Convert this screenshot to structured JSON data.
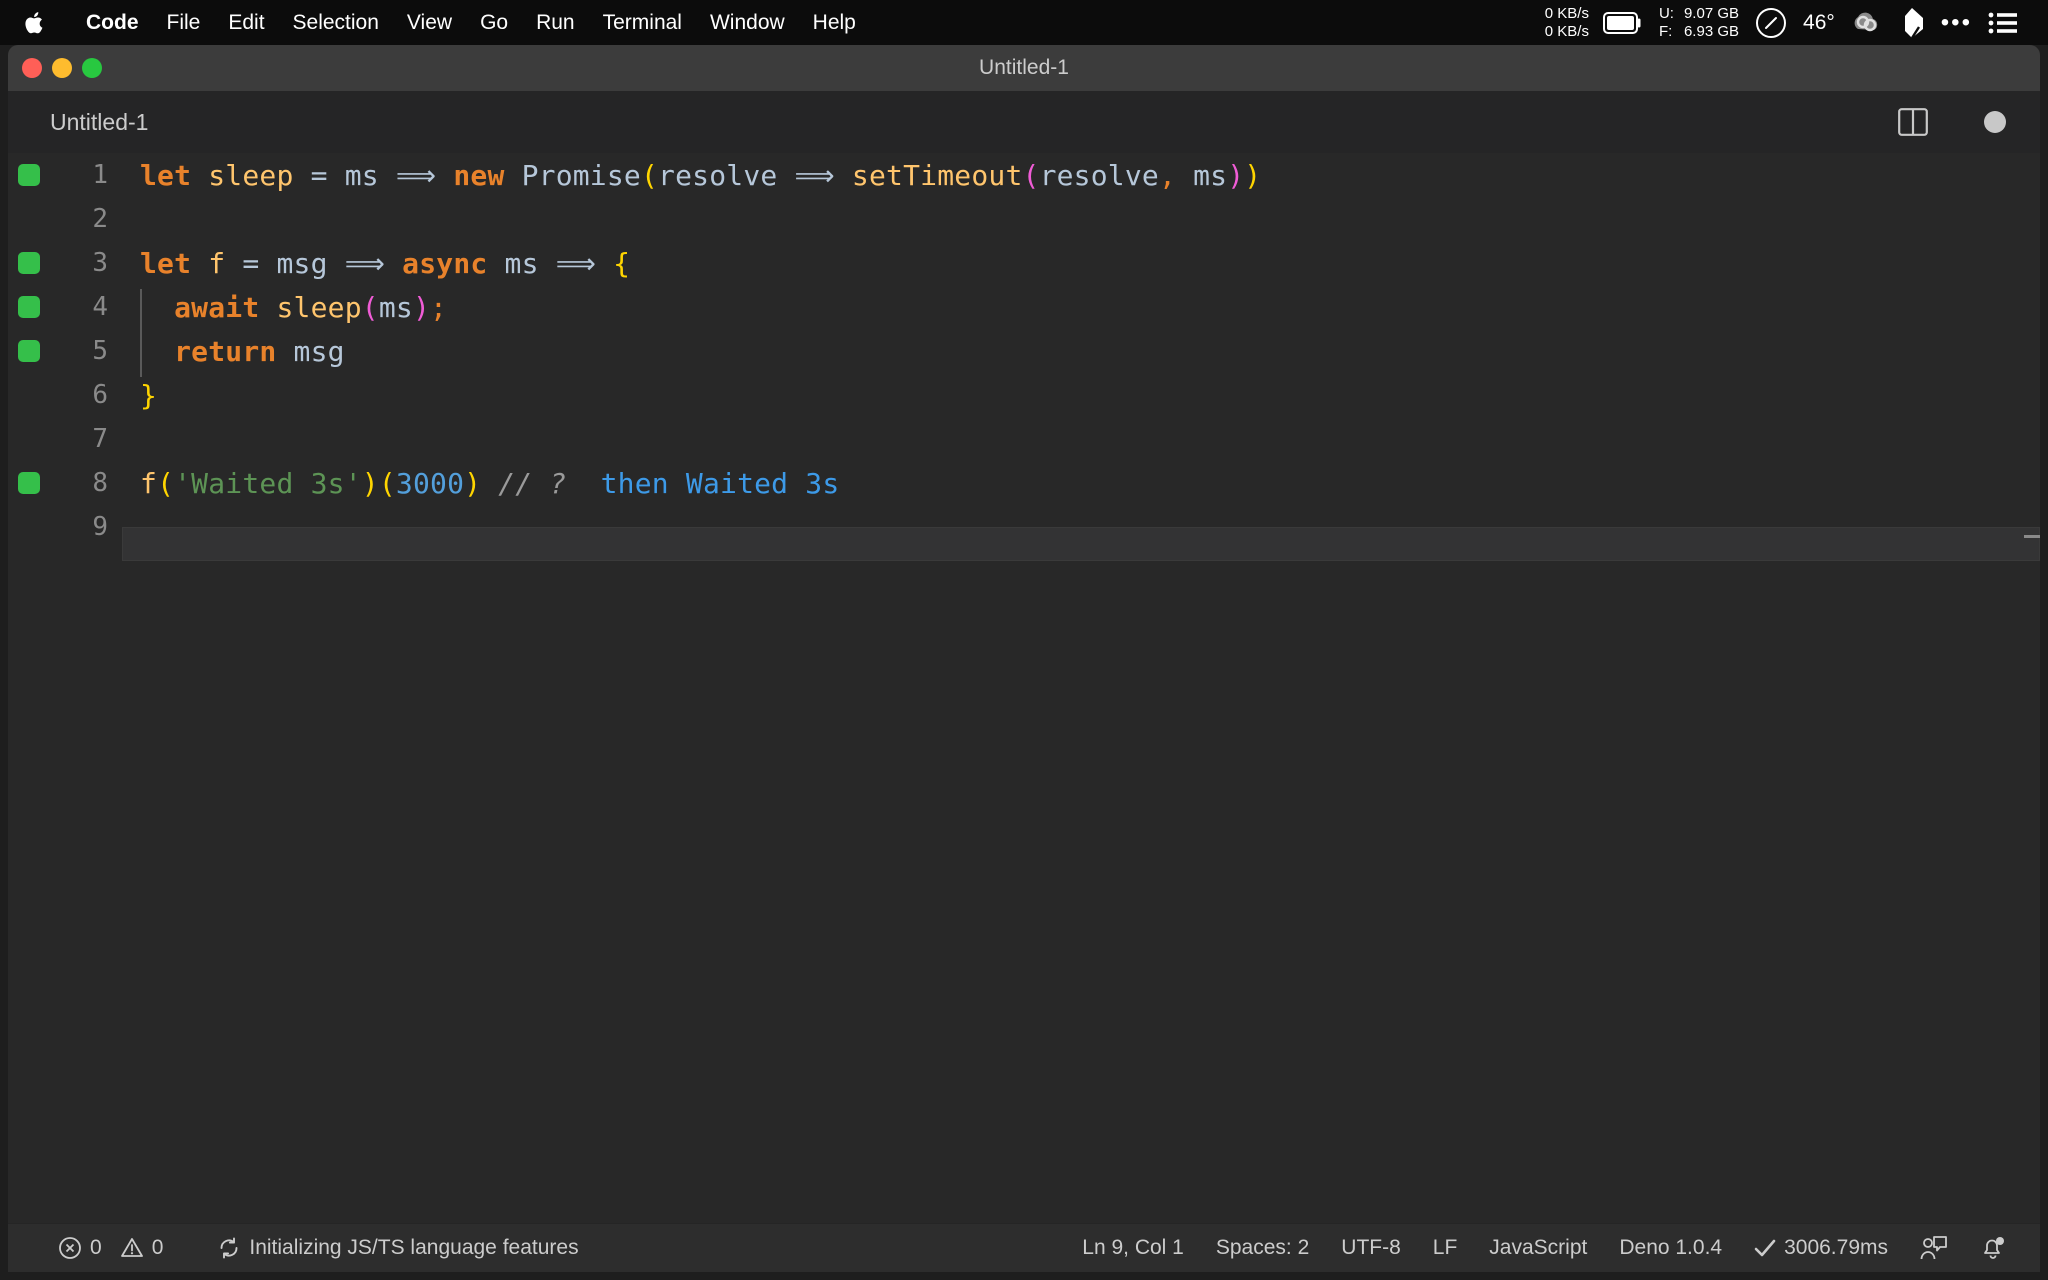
{
  "menubar": {
    "apple_icon": "apple-logo-icon",
    "items": [
      {
        "label": "Code",
        "bold": true
      },
      {
        "label": "File",
        "bold": false
      },
      {
        "label": "Edit",
        "bold": false
      },
      {
        "label": "Selection",
        "bold": false
      },
      {
        "label": "View",
        "bold": false
      },
      {
        "label": "Go",
        "bold": false
      },
      {
        "label": "Run",
        "bold": false
      },
      {
        "label": "Terminal",
        "bold": false
      },
      {
        "label": "Window",
        "bold": false
      },
      {
        "label": "Help",
        "bold": false
      }
    ],
    "network_up": "0 KB/s",
    "network_down": "0 KB/s",
    "battery_icon": "battery-icon",
    "memory_used_label": "U:",
    "memory_free_label": "F:",
    "memory_used_value": "9.07 GB",
    "memory_free_value": "6.93 GB",
    "gauge_icon": "speedometer-icon",
    "temperature": "46°",
    "cloud_icon": "cloud-sync-icon",
    "leaf_icon": "leaf-icon",
    "dots_icon": "ellipsis-icon",
    "list_icon": "control-center-list-icon"
  },
  "window": {
    "title": "Untitled-1",
    "traffic_lights": [
      "close",
      "minimize",
      "maximize"
    ],
    "colors": {
      "close": "#ff5f57",
      "minimize": "#febc2e",
      "maximize": "#28c840"
    }
  },
  "tabrow": {
    "tab_label": "Untitled-1",
    "split_editor_icon": "split-editor-icon",
    "unsaved_dot": "unsaved-changes-dot"
  },
  "editor": {
    "language": "javascript",
    "cursor_line": 9,
    "lines": [
      {
        "number": "1",
        "marked": true,
        "indent_guide": false,
        "current": false,
        "tokens": [
          {
            "t": "let",
            "c": "t-kw"
          },
          {
            "t": " ",
            "c": "t-op"
          },
          {
            "t": "sleep",
            "c": "t-var"
          },
          {
            "t": " = ",
            "c": "t-op"
          },
          {
            "t": "ms",
            "c": "t-param"
          },
          {
            "t": " ⟹ ",
            "c": "t-op"
          },
          {
            "t": "new",
            "c": "t-kw"
          },
          {
            "t": " ",
            "c": "t-op"
          },
          {
            "t": "Promise",
            "c": "t-param"
          },
          {
            "t": "(",
            "c": "t-p1"
          },
          {
            "t": "resolve",
            "c": "t-param"
          },
          {
            "t": " ⟹ ",
            "c": "t-op"
          },
          {
            "t": "setTimeout",
            "c": "t-fn"
          },
          {
            "t": "(",
            "c": "t-p2"
          },
          {
            "t": "resolve",
            "c": "t-param"
          },
          {
            "t": ",",
            "c": "t-punct"
          },
          {
            "t": " ms",
            "c": "t-param"
          },
          {
            "t": ")",
            "c": "t-p2"
          },
          {
            "t": ")",
            "c": "t-p1"
          }
        ]
      },
      {
        "number": "2",
        "marked": false,
        "indent_guide": false,
        "current": false,
        "tokens": []
      },
      {
        "number": "3",
        "marked": true,
        "indent_guide": false,
        "current": false,
        "tokens": [
          {
            "t": "let",
            "c": "t-kw"
          },
          {
            "t": " ",
            "c": "t-op"
          },
          {
            "t": "f",
            "c": "t-var"
          },
          {
            "t": " = ",
            "c": "t-op"
          },
          {
            "t": "msg",
            "c": "t-param"
          },
          {
            "t": " ⟹ ",
            "c": "t-op"
          },
          {
            "t": "async",
            "c": "t-kw"
          },
          {
            "t": " ",
            "c": "t-op"
          },
          {
            "t": "ms",
            "c": "t-param"
          },
          {
            "t": " ⟹ ",
            "c": "t-op"
          },
          {
            "t": "{",
            "c": "t-brace"
          }
        ]
      },
      {
        "number": "4",
        "marked": true,
        "indent_guide": true,
        "current": false,
        "tokens": [
          {
            "t": "  ",
            "c": "t-op"
          },
          {
            "t": "await",
            "c": "t-kw"
          },
          {
            "t": " ",
            "c": "t-op"
          },
          {
            "t": "sleep",
            "c": "t-fn"
          },
          {
            "t": "(",
            "c": "t-p2"
          },
          {
            "t": "ms",
            "c": "t-param"
          },
          {
            "t": ")",
            "c": "t-p2"
          },
          {
            "t": ";",
            "c": "t-punct"
          }
        ]
      },
      {
        "number": "5",
        "marked": true,
        "indent_guide": true,
        "current": false,
        "tokens": [
          {
            "t": "  ",
            "c": "t-op"
          },
          {
            "t": "return",
            "c": "t-kw"
          },
          {
            "t": " ",
            "c": "t-op"
          },
          {
            "t": "msg",
            "c": "t-param"
          }
        ]
      },
      {
        "number": "6",
        "marked": false,
        "indent_guide": false,
        "current": false,
        "tokens": [
          {
            "t": "}",
            "c": "t-brace"
          }
        ]
      },
      {
        "number": "7",
        "marked": false,
        "indent_guide": false,
        "current": false,
        "tokens": []
      },
      {
        "number": "8",
        "marked": true,
        "indent_guide": false,
        "current": false,
        "tokens": [
          {
            "t": "f",
            "c": "t-fn"
          },
          {
            "t": "(",
            "c": "t-p1"
          },
          {
            "t": "'Waited 3s'",
            "c": "t-str"
          },
          {
            "t": ")",
            "c": "t-p1"
          },
          {
            "t": "(",
            "c": "t-p1"
          },
          {
            "t": "3000",
            "c": "t-num"
          },
          {
            "t": ")",
            "c": "t-p1"
          },
          {
            "t": " ",
            "c": "t-op"
          },
          {
            "t": "// ?",
            "c": "t-cmt"
          },
          {
            "t": "  ",
            "c": "t-op"
          },
          {
            "t": "then Waited 3s",
            "c": "t-inline"
          }
        ]
      },
      {
        "number": "9",
        "marked": false,
        "indent_guide": false,
        "current": true,
        "tokens": []
      }
    ]
  },
  "statusbar": {
    "error_icon": "error-circle-icon",
    "error_count": "0",
    "warning_icon": "warning-triangle-icon",
    "warning_count": "0",
    "sync_icon": "sync-spinner-icon",
    "task_status": "Initializing JS/TS language features",
    "cursor_position": "Ln 9, Col 1",
    "indentation": "Spaces: 2",
    "encoding": "UTF-8",
    "line_ending": "LF",
    "language_mode": "JavaScript",
    "runtime": "Deno 1.0.4",
    "run_check_icon": "checkmark-icon",
    "run_time": "3006.79ms",
    "feedback_icon": "feedback-person-icon",
    "bell_icon": "notifications-bell-icon"
  }
}
